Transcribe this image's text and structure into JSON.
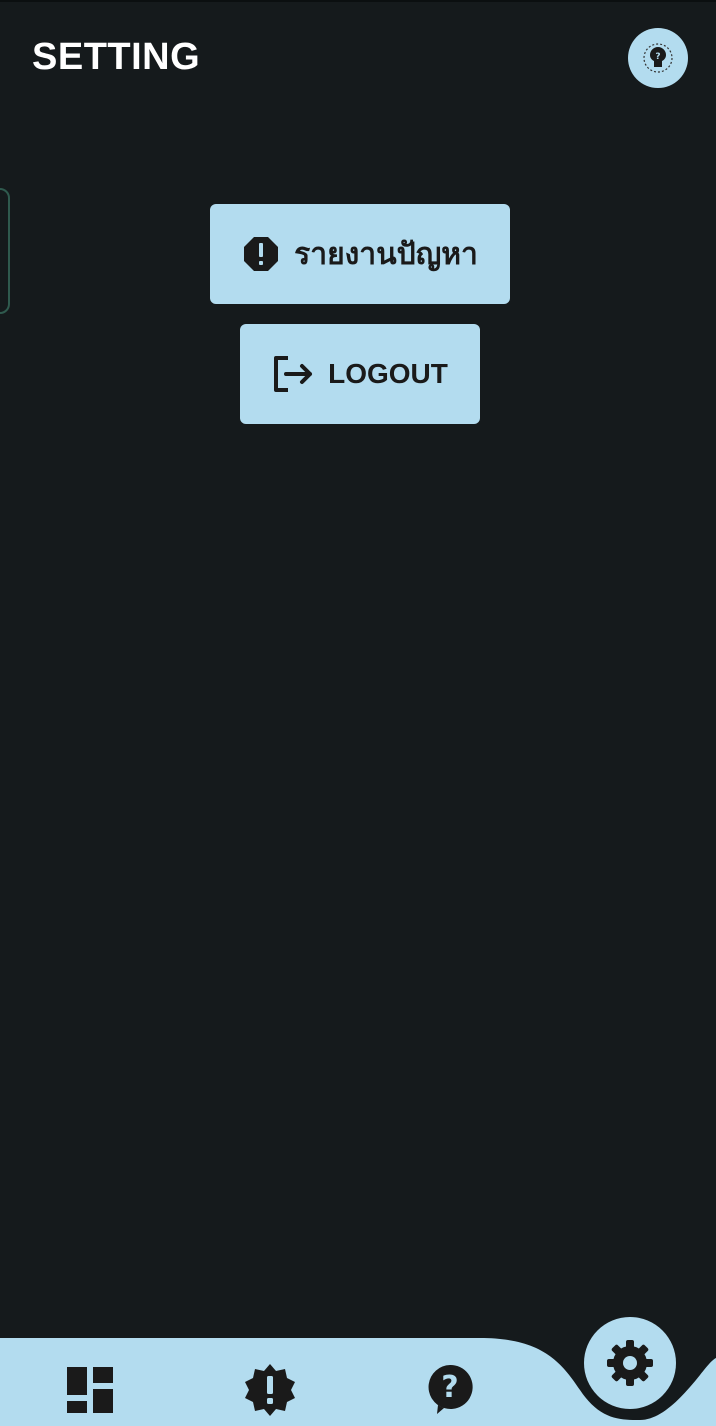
{
  "header": {
    "title": "SETTING",
    "avatar_icon": "person-question-icon"
  },
  "actions": {
    "report": {
      "label": "รายงานปัญหา",
      "icon": "alert-octagon-icon"
    },
    "logout": {
      "label": "LOGOUT",
      "icon": "logout-icon"
    }
  },
  "bottom_nav": {
    "items": [
      {
        "icon": "dashboard-icon"
      },
      {
        "icon": "alert-badge-icon"
      },
      {
        "icon": "help-circle-icon"
      },
      {
        "icon": "gear-icon",
        "active": true
      }
    ]
  },
  "colors": {
    "background": "#151a1c",
    "accent": "#b3dcef",
    "icon_dark": "#1a1a1a",
    "text": "#ffffff"
  }
}
